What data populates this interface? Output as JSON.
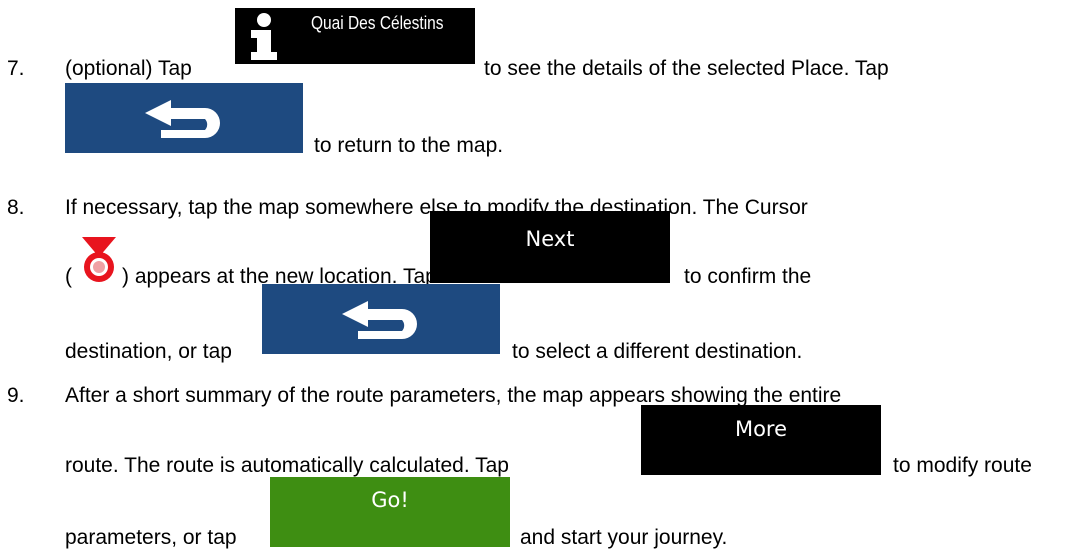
{
  "steps": [
    {
      "number": "7.",
      "line1_a": "(optional) Tap",
      "line1_b": "to see the details of the selected Place. Tap",
      "line2": "to return to the map."
    },
    {
      "number": "8.",
      "line1": "If necessary, tap the map somewhere else to modify the destination. The Cursor",
      "line2_a": "(",
      "line2_b": ") appears at the new location. Tap",
      "line2_c": "to confirm the",
      "line3_a": "destination, or tap",
      "line3_b": "to select a different destination."
    },
    {
      "number": "9.",
      "line1": "After a short summary of the route parameters, the map appears showing the entire",
      "line2_a": "route. The route is automatically calculated. Tap",
      "line2_b": "to modify route",
      "line3_a": "parameters, or tap",
      "line3_b": "and start your journey."
    }
  ],
  "buttons": {
    "place_info": {
      "label": "Quai Des Célestins",
      "icon": "info-icon"
    },
    "back": {
      "icon": "back-arrow-icon"
    },
    "next": {
      "label": "Next"
    },
    "more": {
      "label": "More"
    },
    "go": {
      "label": "Go!"
    }
  },
  "colors": {
    "back_button": "#1e4a80",
    "go_button": "#3e8e12",
    "dark_button": "#000000",
    "cursor": "#e8141e"
  }
}
